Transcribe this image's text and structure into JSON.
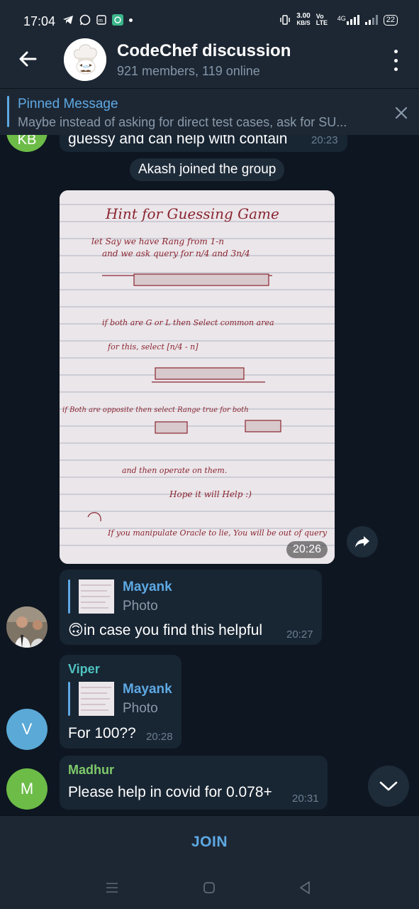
{
  "status_bar": {
    "time": "17:04",
    "speed_value": "3.00",
    "speed_unit": "KB/S",
    "network_type": "4G",
    "volte": "Vo LTE",
    "battery": "22"
  },
  "header": {
    "title": "CodeChef discussion",
    "subtitle": "921 members, 119 online"
  },
  "pinned": {
    "title": "Pinned Message",
    "text": "Maybe instead of asking for direct test cases, ask for SU..."
  },
  "messages": {
    "partial": {
      "text": "guessy and can help with contain",
      "time": "20:23",
      "avatar_initials": "KB"
    },
    "system": "Akash joined the group",
    "photo": {
      "time": "20:26",
      "note_title": "Hint for Guessing Game",
      "note_lines": [
        "let Say we have Rang from 1-n",
        "and we ask query for n/4 and 3n/4",
        "if both are G or L then Select common area",
        "for this, select [n/4 - n]",
        "if Both are opposite then select Range true for both",
        "and then operate on them.",
        "Hope it will Help :)",
        "If you manipulate Oracle to lie, You will be out of query"
      ]
    },
    "reply1": {
      "reply_name": "Mayank",
      "reply_sub": "Photo",
      "text": "🙃in case you find this helpful",
      "time": "20:27"
    },
    "reply2": {
      "sender": "Viper",
      "reply_name": "Mayank",
      "reply_sub": "Photo",
      "text": "For 100??",
      "time": "20:28",
      "avatar_letter": "V"
    },
    "last": {
      "sender": "Madhur",
      "text": "Please help in covid for 0.078+",
      "time": "20:31",
      "avatar_letter": "M"
    }
  },
  "join_label": "JOIN",
  "colors": {
    "accent": "#5ea9e4",
    "bubble": "#182533",
    "background": "#0e1621",
    "header": "#1d2733",
    "viper_name": "#4fc3c0",
    "madhur_name": "#7fc96a",
    "v_avatar": "#5aa9d6",
    "m_avatar": "#6cbc47",
    "kb_avatar": "#6cbc47"
  }
}
